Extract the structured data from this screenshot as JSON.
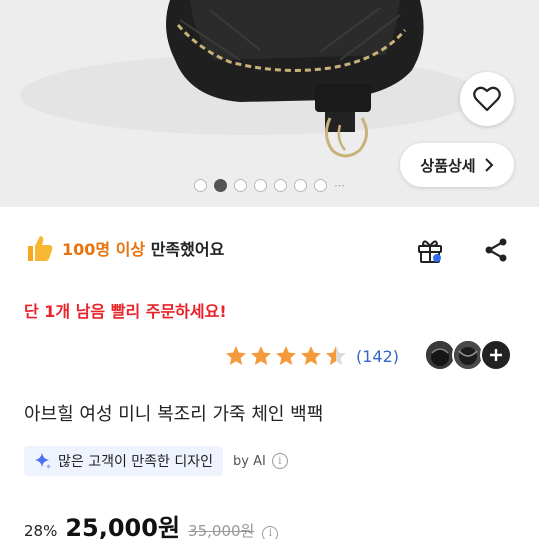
{
  "gallery": {
    "detail_button_label": "상품상세",
    "dots_total": 7,
    "active_index": 1,
    "dots_more_label": "⋯"
  },
  "satisfaction": {
    "count_text": "100명 이상",
    "suffix_text": " 만족했어요",
    "accent_color": "#e8720c"
  },
  "actions": {
    "gift_icon": "gift-icon",
    "share_icon": "share-icon"
  },
  "urgency": {
    "text": "단 1개 남음 빨리 주문하세요!",
    "color": "#e8232a"
  },
  "rating": {
    "stars": 4.5,
    "review_count": "(142)"
  },
  "product": {
    "title": "아브힐 여성 미니 복조리 가죽 체인 백팩"
  },
  "ai_summary": {
    "chip_text": "많은 고객이 만족한 디자인",
    "by_text": "by AI",
    "info_glyph": "i"
  },
  "price": {
    "discount": "28%",
    "sale": "25,000원",
    "original": "35,000원"
  }
}
